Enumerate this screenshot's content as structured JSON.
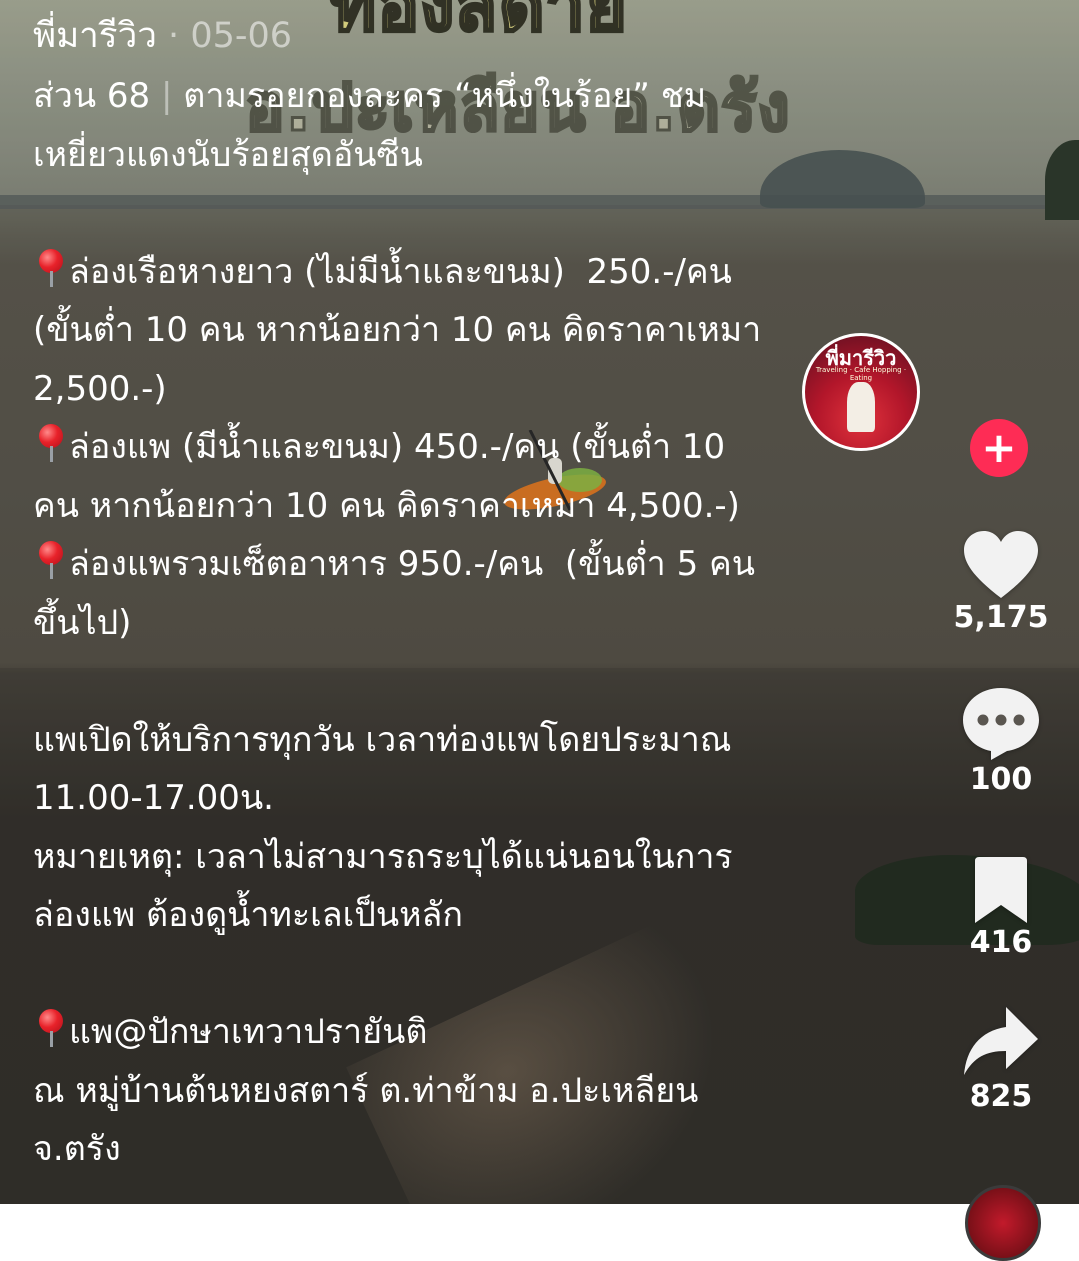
{
  "post": {
    "author": "พี่มารีวิว",
    "separator": "·",
    "date": "05-06",
    "title_part": "ส่วน 68",
    "title_divider": "|",
    "title_rest": "ตามรอยกองละคร “หนึ่งในร้อย” ชม",
    "title_line2": "เหยี่ยวแดงนับร้อยสุดอันซีน",
    "lines": [
      "ล่องเรือหางยาว (ไม่มีน้ำและขนม)  250.-/คน",
      "(ขั้นต่ำ 10 คน หากน้อยกว่า 10 คน คิดราคาเหมา",
      "2,500.-)",
      "ล่องแพ (มีน้ำและขนม) 450.-/คน (ขั้นต่ำ 10",
      "คน หากน้อยกว่า 10 คน คิดราคาเหมา 4,500.-)",
      "ล่องแพรวมเซ็ตอาหาร 950.-/คน  (ขั้นต่ำ 5 คน",
      "ขึ้นไป)",
      "แพเปิดให้บริการทุกวัน เวลาท่องแพโดยประมาณ",
      "11.00-17.00น.",
      "หมายเหตุ: เวลาไม่สามารถระบุได้แน่นอนในการ",
      "ล่องแพ ต้องดูน้ำทะเลเป็นหลัก",
      "แพ@ปักษาเทวาปรายันติ",
      "ณ หมู่บ้านต้นหยงสตาร์ ต.ท่าข้าม อ.ปะเหลียน",
      "จ.ตรัง"
    ]
  },
  "video_overlay": {
    "line1": "ท่องสด้าย",
    "line2": "อ.ปะเหลียน อ.ตรัง"
  },
  "avatar": {
    "name": "พี่มารีวิว",
    "subtitle": "Traveling · Cafe Hopping · Eating"
  },
  "actions": {
    "follow_symbol": "+",
    "likes": "5,175",
    "comments": "100",
    "saves": "416",
    "shares": "825"
  },
  "colors": {
    "follow": "#fe2c55",
    "text": "#ffffff",
    "pin": "#e8222a"
  },
  "icons": [
    "pin-icon",
    "heart-icon",
    "comment-icon",
    "bookmark-icon",
    "share-icon",
    "plus-icon"
  ]
}
